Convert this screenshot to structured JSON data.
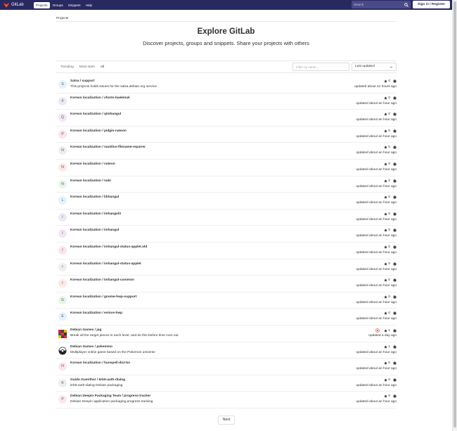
{
  "navbar": {
    "brand": "GitLab",
    "links": [
      "Projects",
      "Groups",
      "Snippets",
      "Help"
    ],
    "search_placeholder": "Search",
    "signin": "Sign in / Register",
    "bg_color": "#292961"
  },
  "breadcrumb": "Projects",
  "hero": {
    "title": "Explore GitLab",
    "subtitle": "Discover projects, groups and snippets. Share your projects with others"
  },
  "filters": {
    "tabs": [
      "Trending",
      "Most stars",
      "All"
    ],
    "filter_placeholder": "Filter by name...",
    "sort_label": "Last updated"
  },
  "projects": [
    {
      "letter": "S",
      "name": "Salsa / support",
      "description": "This projects holds issues for the salsa.debian.org service",
      "stars": "0",
      "updated": "updated about 21 hours ago",
      "avatar_bg": "#e3f2fd"
    },
    {
      "letter": "X",
      "name": "Korean localization / xfonts-baekmuk",
      "description": "",
      "stars": "0",
      "updated": "updated about an hour ago",
      "avatar_bg": "#ede7f6"
    },
    {
      "letter": "Q",
      "name": "Korean localization / qimhangul",
      "description": "",
      "stars": "0",
      "updated": "updated about an hour ago",
      "avatar_bg": "#f3e5f5"
    },
    {
      "letter": "P",
      "name": "Korean localization / pidgin-nateon",
      "description": "",
      "stars": "0",
      "updated": "updated about an hour ago",
      "avatar_bg": "#fce4ec"
    },
    {
      "letter": "N",
      "name": "Korean localization / nautilus-filename-repairer",
      "description": "",
      "stars": "0",
      "updated": "updated about an hour ago",
      "avatar_bg": "#eeeeee"
    },
    {
      "letter": "N",
      "name": "Korean localization / nateon",
      "description": "",
      "stars": "0",
      "updated": "updated about an hour ago",
      "avatar_bg": "#fbe9e7"
    },
    {
      "letter": "N",
      "name": "Korean localization / nabi",
      "description": "",
      "stars": "0",
      "updated": "updated about an hour ago",
      "avatar_bg": "#e8f5e9"
    },
    {
      "letter": "L",
      "name": "Korean localization / libhangul",
      "description": "",
      "stars": "0",
      "updated": "updated about an hour ago",
      "avatar_bg": "#e3f2fd"
    },
    {
      "letter": "I",
      "name": "Korean localization / imhangul3",
      "description": "",
      "stars": "0",
      "updated": "updated about an hour ago",
      "avatar_bg": "#ede7f6"
    },
    {
      "letter": "I",
      "name": "Korean localization / imhangul",
      "description": "",
      "stars": "0",
      "updated": "updated about an hour ago",
      "avatar_bg": "#f3e5f5"
    },
    {
      "letter": "I",
      "name": "Korean localization / imhangul-status-applet.old",
      "description": "",
      "stars": "0",
      "updated": "updated about an hour ago",
      "avatar_bg": "#fce4ec"
    },
    {
      "letter": "I",
      "name": "Korean localization / imhangul-status-applet",
      "description": "",
      "stars": "0",
      "updated": "updated about an hour ago",
      "avatar_bg": "#eeeeee"
    },
    {
      "letter": "I",
      "name": "Korean localization / imhangul-common",
      "description": "",
      "stars": "0",
      "updated": "updated about an hour ago",
      "avatar_bg": "#fbe9e7"
    },
    {
      "letter": "G",
      "name": "Korean localization / gnome-hwp-support",
      "description": "",
      "stars": "0",
      "updated": "updated about an hour ago",
      "avatar_bg": "#e8f5e9"
    },
    {
      "letter": "E",
      "name": "Korean localization / evince-hwp",
      "description": "",
      "stars": "0",
      "updated": "updated about an hour ago",
      "avatar_bg": "#e3f2fd"
    },
    {
      "letter": "",
      "name": "Debian Games / jag",
      "description": "Break all the target pieces in each level, and do this before time runs out",
      "stars": "1",
      "updated": "updated a day ago",
      "image_avatar": "jag-icon",
      "pipeline_failed": true
    },
    {
      "letter": "",
      "name": "Debian Games / pokemmo",
      "description": "Multiplayer online game based on the Pokemon universe",
      "stars": "1",
      "updated": "updated about an hour ago",
      "image_avatar": "pokeball-icon"
    },
    {
      "letter": "H",
      "name": "Korean localization / hunspell-dict-ko",
      "description": "",
      "stars": "0",
      "updated": "updated about an hour ago",
      "avatar_bg": "#fce4ec"
    },
    {
      "letter": "K",
      "name": "Guido Guenther / krb5-auth-dialog",
      "description": "krb5-auth-dialog Debian packaging",
      "stars": "0",
      "updated": "updated about an hour ago",
      "avatar_bg": "#eeeeee"
    },
    {
      "letter": "P",
      "name": "Debian Deepin Packaging Team / progress-tracker",
      "description": "Debian Deepin application packaging progress tracking",
      "stars": "0",
      "updated": "updated about an hour ago",
      "avatar_bg": "#fbe9e7"
    }
  ],
  "pagination": {
    "next": "Next"
  }
}
